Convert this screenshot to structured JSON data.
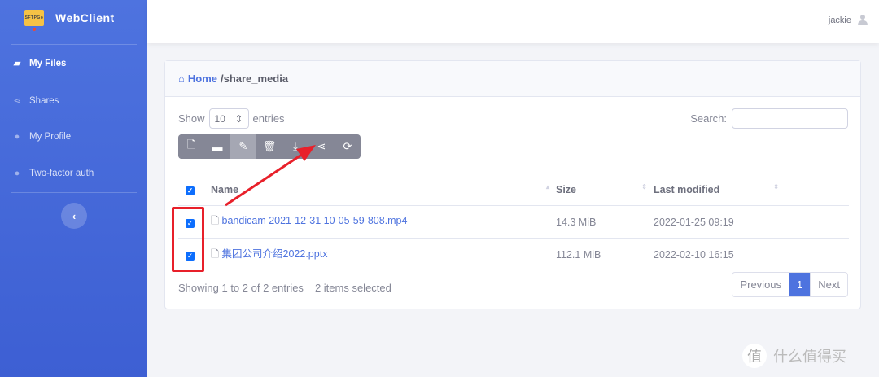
{
  "sidebar": {
    "brand": "WebClient",
    "logo_text": "SFTPGo",
    "items": [
      {
        "label": "My Files",
        "icon": "folder-open-icon"
      },
      {
        "label": "Shares",
        "icon": "share-icon"
      },
      {
        "label": "My Profile",
        "icon": "user-icon"
      },
      {
        "label": "Two-factor auth",
        "icon": "user-lock-icon"
      }
    ],
    "collapse": "‹"
  },
  "topbar": {
    "username": "jackie"
  },
  "breadcrumb": {
    "home": "Home",
    "path": "/share_media"
  },
  "controls": {
    "show": "Show",
    "page_size": "10",
    "entries": "entries",
    "search_label": "Search:",
    "search_value": ""
  },
  "toolbar": [
    "file-upload-icon",
    "folder-add-icon",
    "rename-icon",
    "delete-icon",
    "download-icon",
    "share-icon",
    "refresh-icon"
  ],
  "table": {
    "columns": [
      "Name",
      "Size",
      "Last modified"
    ],
    "rows": [
      {
        "name": "bandicam 2021-12-31 10-05-59-808.mp4",
        "size": "14.3 MiB",
        "modified": "2022-01-25 09:19",
        "checked": true
      },
      {
        "name": "集团公司介绍2022.pptx",
        "size": "112.1 MiB",
        "modified": "2022-02-10 16:15",
        "checked": true
      }
    ]
  },
  "footer": {
    "info": "Showing 1 to 2 of 2 entries",
    "selected": "2 items selected",
    "previous": "Previous",
    "page": "1",
    "next": "Next"
  },
  "watermark": {
    "badge": "值",
    "text": "什么值得买"
  },
  "colors": {
    "primary": "#4e73df",
    "annotation": "#e8202a",
    "toolbar": "#858796"
  }
}
